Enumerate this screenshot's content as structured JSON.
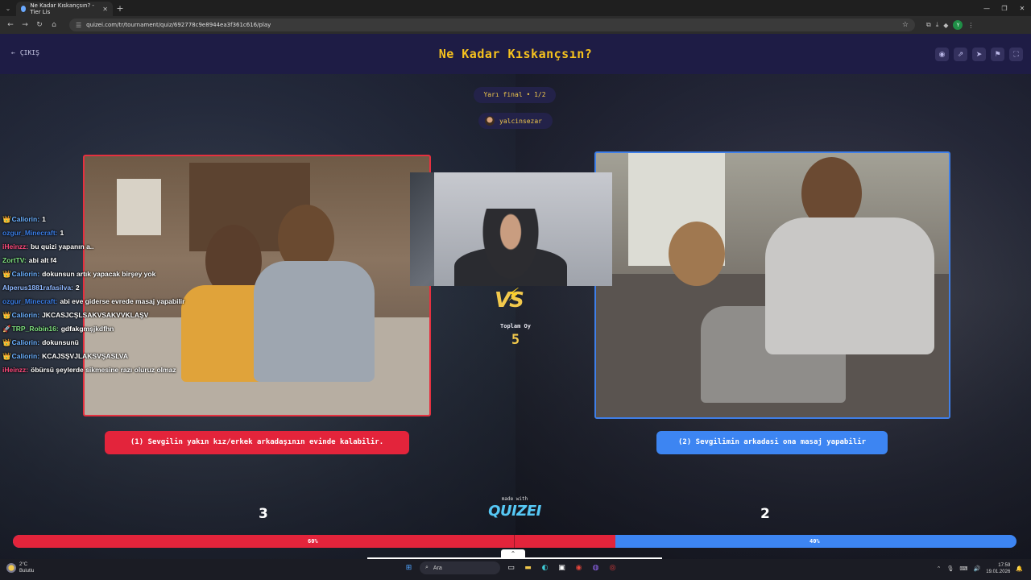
{
  "browser": {
    "tab_title": "Ne Kadar Kıskançsın? - Tier Lis",
    "url": "quizei.com/tr/tournament/quiz/692778c9e8944ea3f361c616/play",
    "profile_initial": "Y"
  },
  "header": {
    "exit_label": "ÇIKIŞ",
    "title": "Ne Kadar Kıskançsın?"
  },
  "round": {
    "label": "Yarı final • 1/2",
    "username": "yalcinsezar"
  },
  "vs": {
    "text": "VS",
    "total_label": "Toplam Oy",
    "total_value": "5"
  },
  "options": [
    {
      "label": "(1) Sevgilin yakın kız/erkek arkadaşının evinde kalabilir.",
      "votes": "3",
      "percent_label": "60%",
      "percent": 60,
      "color": "#e3243b"
    },
    {
      "label": "(2) Sevgilimin arkadasi ona masaj yapabilir",
      "votes": "2",
      "percent_label": "40%",
      "percent": 40,
      "color": "#3d85f2"
    }
  ],
  "brand": {
    "made_with": "made with",
    "name": "QUIZEI"
  },
  "chat": [
    {
      "badge": "👑",
      "name": "Caliorin:",
      "name_color": "#6ab0ff",
      "msg": "1"
    },
    {
      "badge": "",
      "name": "ozgur_Minecraft:",
      "name_color": "#3a7ee8",
      "msg": "1"
    },
    {
      "badge": "",
      "name": "iHeinzz:",
      "name_color": "#ff4b7d",
      "msg": "bu quizi yapanın a.."
    },
    {
      "badge": "",
      "name": "ZortTV:",
      "name_color": "#7ee07e",
      "msg": "abi alt f4"
    },
    {
      "badge": "👑",
      "name": "Caliorin:",
      "name_color": "#6ab0ff",
      "msg": "dokunsun artık yapacak birşey yok"
    },
    {
      "badge": "",
      "name": "Alperus1881rafasilva:",
      "name_color": "#8fb8ff",
      "msg": "2"
    },
    {
      "badge": "",
      "name": "ozgur_Minecraft:",
      "name_color": "#3a7ee8",
      "msg": "abi eve giderse evrede masaj yapabilir"
    },
    {
      "badge": "👑",
      "name": "Caliorin:",
      "name_color": "#6ab0ff",
      "msg": "JKCASJCŞLSAKVSAKVVKLAŞV"
    },
    {
      "badge": "🚀",
      "name": "TRP_Robin16:",
      "name_color": "#7ee07e",
      "msg": "gdfakgmşjkdfhn"
    },
    {
      "badge": "👑",
      "name": "Caliorin:",
      "name_color": "#6ab0ff",
      "msg": "dokunsunü"
    },
    {
      "badge": "👑",
      "name": "Caliorin:",
      "name_color": "#6ab0ff",
      "msg": "KCAJSŞVJLAKSVŞASLVA"
    },
    {
      "badge": "",
      "name": "iHeinzz:",
      "name_color": "#ff4b7d",
      "msg": "öbürsü şeylerde sikmesine razı oluruz olmaz"
    }
  ],
  "taskbar": {
    "temperature": "2°C",
    "weather": "Bulutlu",
    "search_placeholder": "Ara",
    "time": "17:59",
    "date": "19.01.2026"
  }
}
